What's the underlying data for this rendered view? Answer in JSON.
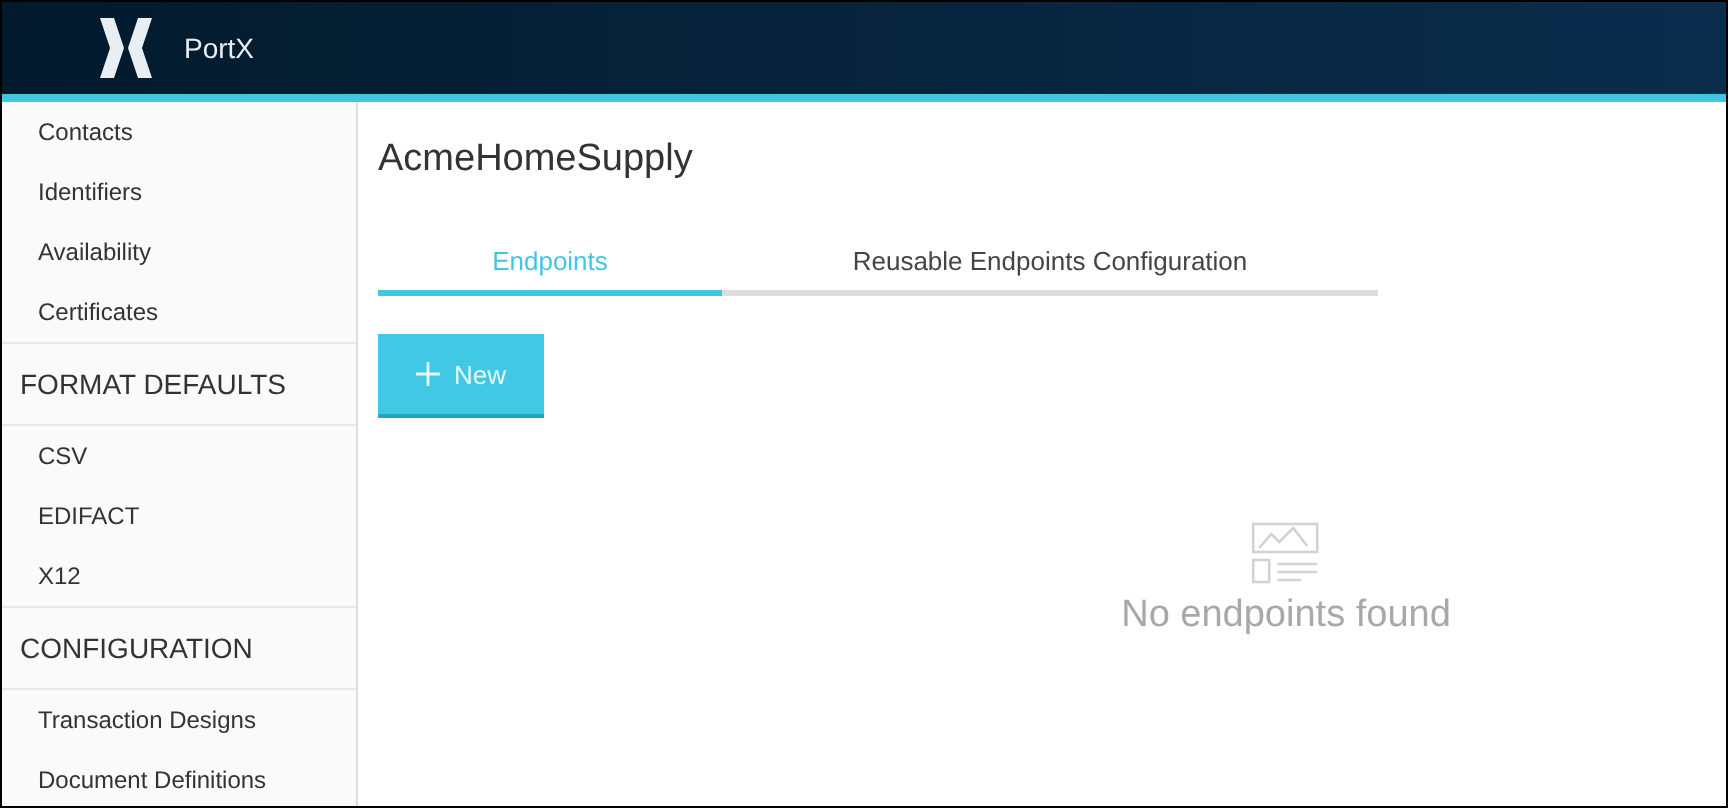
{
  "header": {
    "app_name": "PortX"
  },
  "sidebar": [
    {
      "kind": "item",
      "label": "Contacts"
    },
    {
      "kind": "item",
      "label": "Identifiers"
    },
    {
      "kind": "item",
      "label": "Availability"
    },
    {
      "kind": "item",
      "label": "Certificates"
    },
    {
      "kind": "heading",
      "label": "FORMAT DEFAULTS"
    },
    {
      "kind": "item",
      "label": "CSV"
    },
    {
      "kind": "item",
      "label": "EDIFACT"
    },
    {
      "kind": "item",
      "label": "X12"
    },
    {
      "kind": "heading",
      "label": "CONFIGURATION"
    },
    {
      "kind": "item",
      "label": "Transaction Designs"
    },
    {
      "kind": "item",
      "label": "Document Definitions"
    }
  ],
  "page_title": "AcmeHomeSupply",
  "tabs": [
    {
      "label": "Endpoints",
      "selected": true
    },
    {
      "label": "Reusable Endpoints Configuration",
      "selected": false
    }
  ],
  "new_button": {
    "label": "New"
  },
  "empty_state": {
    "message": "No endpoints found"
  }
}
